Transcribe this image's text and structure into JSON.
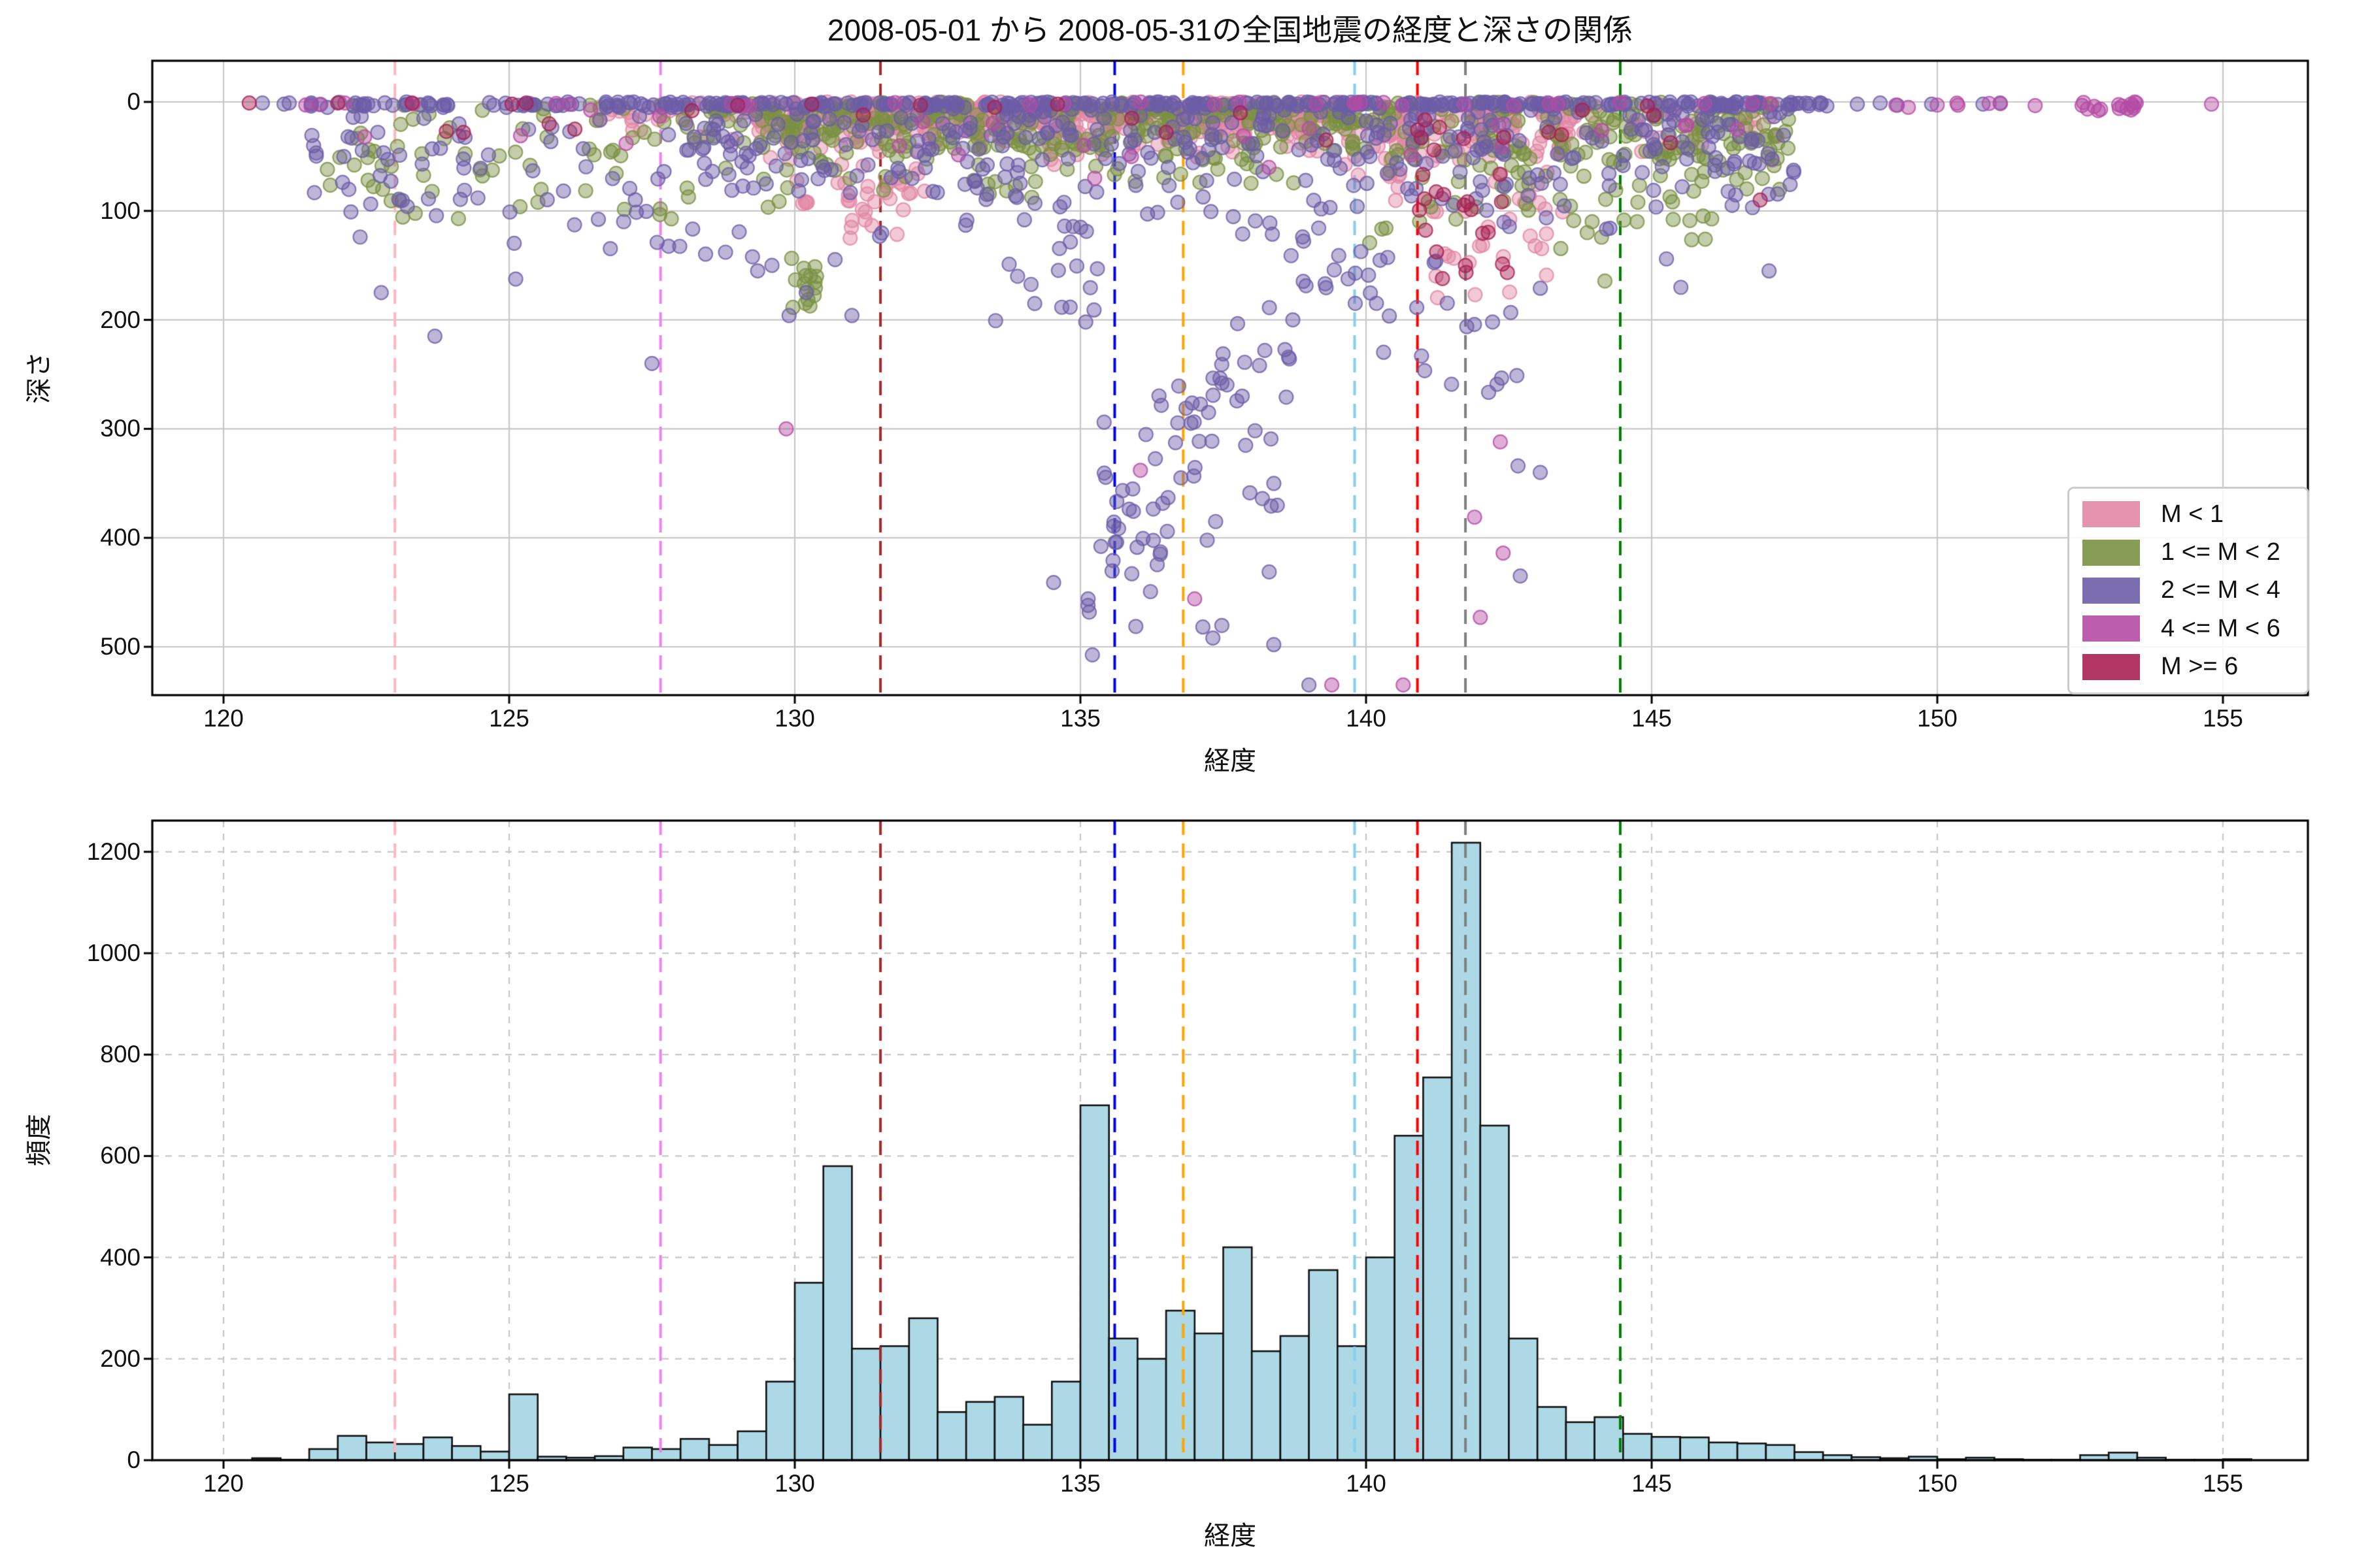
{
  "title": "2008-05-01 から 2008-05-31の全国地震の経度と深さの関係",
  "axes": {
    "top": {
      "xlabel": "経度",
      "ylabel": "深さ",
      "x_ticks": [
        120,
        125,
        130,
        135,
        140,
        145,
        150,
        155
      ],
      "y_ticks": [
        0,
        100,
        200,
        300,
        400,
        500
      ],
      "xlim": [
        118.75,
        156.49
      ],
      "depth_lim": [
        -38,
        544
      ],
      "y_inverted": true,
      "grid_style": "solid"
    },
    "bottom": {
      "xlabel": "経度",
      "ylabel": "頻度",
      "x_ticks": [
        120,
        125,
        130,
        135,
        140,
        145,
        150,
        155
      ],
      "y_ticks": [
        0,
        200,
        400,
        600,
        800,
        1000,
        1200
      ],
      "xlim": [
        118.75,
        156.49
      ],
      "ylim": [
        0,
        1261
      ],
      "grid_style": "dashed"
    }
  },
  "legend": {
    "entries": [
      {
        "label": "M < 1",
        "color": "#E287A5"
      },
      {
        "label": "1 <= M < 2",
        "color": "#7A9142"
      },
      {
        "label": "2 <= M < 4",
        "color": "#6C5EA8"
      },
      {
        "label": "4 <= M < 6",
        "color": "#B54BA5"
      },
      {
        "label": "M >= 6",
        "color": "#A82052"
      }
    ]
  },
  "vlines": [
    {
      "x": 123.0,
      "color": "#FFB6C1"
    },
    {
      "x": 127.65,
      "color": "#EE82EE"
    },
    {
      "x": 131.5,
      "color": "#A52A2A"
    },
    {
      "x": 135.6,
      "color": "#0000EE"
    },
    {
      "x": 136.8,
      "color": "#FFA500"
    },
    {
      "x": 139.8,
      "color": "#87CEEB"
    },
    {
      "x": 140.9,
      "color": "#FF0000"
    },
    {
      "x": 141.74,
      "color": "#808080"
    },
    {
      "x": 144.45,
      "color": "#008000"
    }
  ],
  "chart_data": [
    {
      "type": "scatter",
      "title": "2008-05-01 から 2008-05-31の全国地震の経度と深さの関係",
      "xlabel": "経度",
      "ylabel": "深さ",
      "x_range": [
        118.75,
        156.49
      ],
      "depth_range": [
        -38,
        544
      ],
      "y_inverted": true,
      "marker": {
        "radius": 10.5,
        "fill_alpha": 0.45,
        "edge_alpha": 0.8
      },
      "series": [
        {
          "name": "M < 1",
          "color": "#E287A5",
          "clusters": [
            {
              "mode": "absgauss",
              "x0": 129.3,
              "x1": 139.6,
              "sd": 20,
              "dmax": 65,
              "count": 500
            },
            {
              "mode": "absgauss",
              "x0": 139.6,
              "x1": 143.6,
              "sd": 38,
              "dmax": 110,
              "count": 130
            },
            {
              "mode": "box",
              "x0": 130.0,
              "x1": 132.3,
              "d0": 55,
              "d1": 125,
              "count": 35
            },
            {
              "mode": "box",
              "x0": 141.0,
              "x1": 143.2,
              "d0": 90,
              "d1": 185,
              "count": 22
            },
            {
              "mode": "absgauss",
              "x0": 126.5,
              "x1": 129.3,
              "sd": 15,
              "dmax": 45,
              "count": 30
            },
            {
              "mode": "absgauss",
              "x0": 143.6,
              "x1": 147.2,
              "sd": 22,
              "dmax": 70,
              "count": 35
            }
          ]
        },
        {
          "name": "1 <= M < 2",
          "color": "#7A9142",
          "clusters": [
            {
              "mode": "absgauss",
              "x0": 128.3,
              "x1": 140.0,
              "sd": 32,
              "dmax": 110,
              "count": 330
            },
            {
              "mode": "absgauss",
              "x0": 140.0,
              "x1": 147.4,
              "sd": 60,
              "dmax": 185,
              "count": 230
            },
            {
              "mode": "gauss",
              "x0": 121.8,
              "x1": 128.3,
              "mean": 45,
              "sd": 35,
              "d0": 3,
              "d1": 140,
              "count": 75
            },
            {
              "mode": "box",
              "x0": 129.9,
              "x1": 130.4,
              "d0": 140,
              "d1": 190,
              "count": 16
            },
            {
              "mode": "box",
              "x0": 133.0,
              "x1": 136.3,
              "d0": 30,
              "d1": 90,
              "count": 20
            }
          ]
        },
        {
          "name": "2 <= M < 4",
          "color": "#6C5EA8",
          "clusters": [
            {
              "mode": "box",
              "x0": 121.4,
              "x1": 128.0,
              "d0": 0,
              "d1": 4,
              "count": 60
            },
            {
              "mode": "box",
              "x0": 128.0,
              "x1": 148.2,
              "d0": 0,
              "d1": 4,
              "count": 280
            },
            {
              "mode": "absgauss",
              "x0": 128.0,
              "x1": 147.5,
              "sd": 60,
              "dmax": 190,
              "count": 420
            },
            {
              "mode": "gauss",
              "x0": 121.5,
              "x1": 128.0,
              "mean": 60,
              "sd": 45,
              "d0": 5,
              "d1": 175,
              "count": 80
            },
            {
              "mode": "line",
              "x0": 135.3,
              "d0": 390,
              "x1": 139.4,
              "d1": 145,
              "xsd": 0.22,
              "dsd": 26,
              "count": 42
            },
            {
              "mode": "line",
              "x0": 139.5,
              "d0": 150,
              "x1": 142.6,
              "d1": 245,
              "xsd": 0.2,
              "dsd": 30,
              "count": 26
            },
            {
              "mode": "box",
              "x0": 134.4,
              "x1": 138.7,
              "d0": 385,
              "d1": 515,
              "count": 24
            },
            {
              "mode": "box",
              "x0": 135.4,
              "x1": 139.0,
              "d0": 250,
              "d1": 390,
              "count": 26
            },
            {
              "mode": "box",
              "x0": 133.3,
              "x1": 135.3,
              "d0": 80,
              "d1": 215,
              "count": 18
            },
            {
              "mode": "points",
              "pts": [
                [
                  123.7,
                  215
                ],
                [
                  127.5,
                  240
                ],
                [
                  129.6,
                  150
                ],
                [
                  129.9,
                  196
                ],
                [
                  130.2,
                  175
                ],
                [
                  133.9,
                  160
                ],
                [
                  134.2,
                  185
                ],
                [
                  139.0,
                  535
                ],
                [
                  142.66,
                  334
                ],
                [
                  142.7,
                  435
                ],
                [
                  143.05,
                  340
                ],
                [
                  129.35,
                  155
                ],
                [
                  131.0,
                  196
                ],
                [
                  120.68,
                  1
                ],
                [
                  121.06,
                  2
                ],
                [
                  121.15,
                  1
                ],
                [
                  148.6,
                  2
                ],
                [
                  149.0,
                  1
                ],
                [
                  149.3,
                  3
                ],
                [
                  149.9,
                  2
                ],
                [
                  150.8,
                  2
                ],
                [
                  151.1,
                  1
                ]
              ]
            }
          ]
        },
        {
          "name": "4 <= M < 6",
          "color": "#B54BA5",
          "clusters": [
            {
              "mode": "box",
              "x0": 120.7,
              "x1": 148.0,
              "d0": 0,
              "d1": 4,
              "count": 26
            },
            {
              "mode": "box",
              "x0": 148.6,
              "x1": 151.9,
              "d0": 0,
              "d1": 5,
              "count": 8
            },
            {
              "mode": "box",
              "x0": 152.4,
              "x1": 153.5,
              "d0": 0,
              "d1": 8,
              "count": 16
            },
            {
              "mode": "box",
              "x0": 121.0,
              "x1": 147.0,
              "d0": 0,
              "d1": 55,
              "count": 20
            },
            {
              "mode": "points",
              "pts": [
                [
                  154.8,
                  2
                ],
                [
                  122.47,
                  32
                ],
                [
                  125.2,
                  31
                ],
                [
                  129.85,
                  300
                ],
                [
                  136.05,
                  338
                ],
                [
                  137.0,
                  456
                ],
                [
                  139.4,
                  535
                ],
                [
                  140.65,
                  535
                ],
                [
                  142.0,
                  473
                ],
                [
                  142.4,
                  414
                ],
                [
                  141.9,
                  381
                ],
                [
                  142.35,
                  312
                ],
                [
                  135.25,
                  70
                ],
                [
                  138.3,
                  60
                ],
                [
                  146.5,
                  25
                ]
              ]
            }
          ]
        },
        {
          "name": "M >= 6",
          "color": "#A82052",
          "clusters": [
            {
              "mode": "points",
              "pts": [
                [
                  120.45,
                  1
                ],
                [
                  122.0,
                  1
                ],
                [
                  123.3,
                  1
                ],
                [
                  125.05,
                  2
                ],
                [
                  125.3,
                  1
                ],
                [
                  126.15,
                  25
                ],
                [
                  123.9,
                  27
                ],
                [
                  124.2,
                  28
                ],
                [
                  128.2,
                  8
                ],
                [
                  129.0,
                  3
                ],
                [
                  131.2,
                  12
                ],
                [
                  133.5,
                  5
                ],
                [
                  135.9,
                  15
                ],
                [
                  137.8,
                  10
                ],
                [
                  139.3,
                  35
                ],
                [
                  125.7,
                  20
                ],
                [
                  130.3,
                  2
                ],
                [
                  132.2,
                  3
                ],
                [
                  134.6,
                  2
                ],
                [
                  136.5,
                  28
                ],
                [
                  146.9,
                  90
                ]
              ]
            },
            {
              "mode": "box",
              "x0": 140.7,
              "x1": 142.5,
              "d0": 15,
              "d1": 170,
              "count": 26
            },
            {
              "mode": "box",
              "x0": 143.0,
              "x1": 147.0,
              "d0": 0,
              "d1": 40,
              "count": 6
            }
          ]
        }
      ]
    },
    {
      "type": "bar",
      "histogram": true,
      "xlabel": "経度",
      "ylabel": "頻度",
      "bin_start": 120.5,
      "bin_width": 0.5,
      "values": [
        4,
        1,
        22,
        48,
        35,
        32,
        45,
        28,
        17,
        130,
        7,
        5,
        8,
        25,
        22,
        42,
        30,
        57,
        155,
        350,
        580,
        220,
        225,
        280,
        95,
        115,
        125,
        70,
        155,
        700,
        240,
        200,
        295,
        250,
        420,
        215,
        245,
        375,
        225,
        400,
        640,
        755,
        1218,
        660,
        240,
        105,
        75,
        85,
        52,
        46,
        45,
        35,
        33,
        30,
        16,
        10,
        6,
        4,
        7,
        2,
        5,
        2,
        1,
        1,
        10,
        15,
        5,
        1,
        1,
        2
      ],
      "ylim": [
        0,
        1261
      ],
      "bar_color": "#ADD8E6",
      "edge_color": "#111111"
    }
  ]
}
